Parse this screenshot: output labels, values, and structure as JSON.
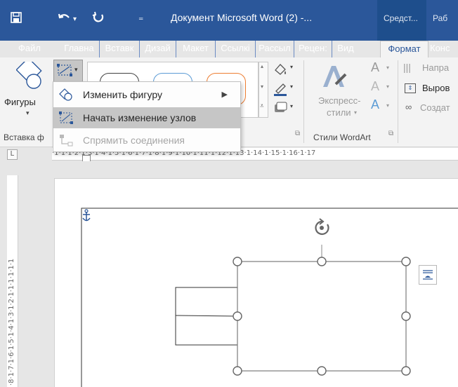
{
  "titlebar": {
    "save_icon": "save-icon",
    "undo_icon": "undo-icon",
    "redo_icon": "redo-icon",
    "customize_icon": "customize-qat-icon",
    "document_title": "Документ Microsoft Word (2) -...",
    "context_group_1": "Средст...",
    "context_group_2": "Раб"
  },
  "tabs": [
    "Файл",
    "Главна",
    "Вставк",
    "Дизай",
    "Макет",
    "Ссылкі",
    "Рассыл",
    "Рецен:",
    "Вид",
    "Формат",
    "Конс"
  ],
  "ribbon": {
    "shapes_label": "Фигуры",
    "insert_shapes_group": "Вставка ф",
    "express_styles_1": "Экспресс-",
    "express_styles_2": "стили",
    "wordart_group": "Стили WordArt",
    "text_direction": "Напра",
    "align_text": "Выров",
    "create_link": "Создат"
  },
  "menu": {
    "items": [
      {
        "label": "Изменить фигуру",
        "has_submenu": true,
        "icon": "change-shape-icon"
      },
      {
        "label": "Начать изменение узлов",
        "highlighted": true,
        "icon": "edit-points-icon"
      },
      {
        "label": "Спрямить соединения",
        "disabled": true,
        "icon": "reroute-connectors-icon"
      }
    ]
  },
  "ruler": {
    "corner": "L",
    "horizontal": "·1·1·1·2·1·3·1·4·1·5·1·6·1·7·1·8·1·9·1·10·1·11·1·12·1·13·1·14·1·15·1·16·1·17",
    "vertical": "·8·1·7·1·6·1·5·1·4·1·3·1·2·1·1·1·1·1·1"
  },
  "colors": {
    "title_bar": "#2b579a",
    "context_bar": "#1e4e8c",
    "ribbon_bg": "#f3f3f3",
    "menu_highlight": "#c6c6c6",
    "shape_style_1": "#404040",
    "shape_style_2": "#5b9bd5",
    "shape_style_3": "#ed7d31"
  }
}
